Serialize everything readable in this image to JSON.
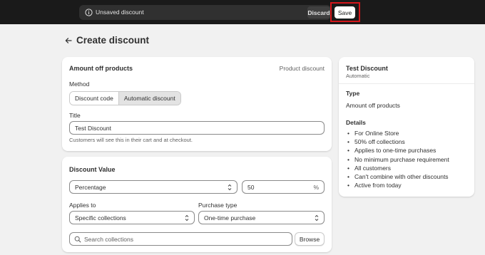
{
  "topbar": {
    "unsaved_text": "Unsaved discount",
    "discard_label": "Discard",
    "save_label": "Save"
  },
  "page": {
    "title": "Create discount"
  },
  "method_card": {
    "title": "Amount off products",
    "type_label": "Product discount",
    "method_label": "Method",
    "method_options": [
      "Discount code",
      "Automatic discount"
    ],
    "method_selected": "Automatic discount",
    "title_label": "Title",
    "title_value": "Test Discount",
    "help_text": "Customers will see this in their cart and at checkout."
  },
  "value_card": {
    "title": "Discount Value",
    "value_type": "Percentage",
    "value_amount": "50",
    "value_suffix": "%",
    "applies_to_label": "Applies to",
    "applies_to_value": "Specific collections",
    "purchase_type_label": "Purchase type",
    "purchase_type_value": "One-time purchase",
    "search_placeholder": "Search collections",
    "browse_label": "Browse"
  },
  "summary": {
    "name": "Test Discount",
    "method": "Automatic",
    "type_heading": "Type",
    "type_value": "Amount off products",
    "details_heading": "Details",
    "details": [
      "For Online Store",
      "50% off collections",
      "Applies to one-time purchases",
      "No minimum purchase requirement",
      "All customers",
      "Can't combine with other discounts",
      "Active from today"
    ]
  },
  "colors": {
    "topbar_bg": "#1a1a1a",
    "page_bg": "#f1f1f1",
    "highlight": "#d4171b"
  },
  "icons": [
    "info-icon",
    "back-arrow-icon",
    "select-chevron-icon",
    "search-icon"
  ]
}
